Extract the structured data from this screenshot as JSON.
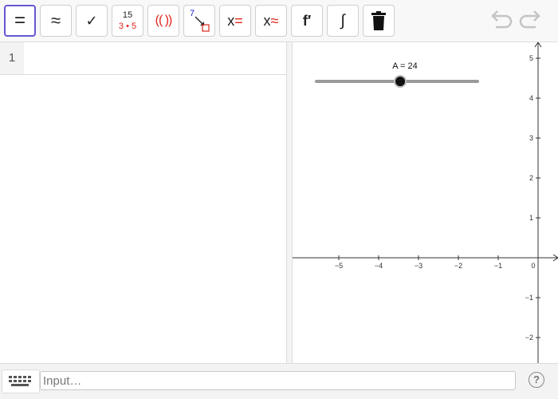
{
  "toolbar": {
    "buttons": [
      {
        "name": "evaluate",
        "label": "="
      },
      {
        "name": "numeric",
        "label": "≈"
      },
      {
        "name": "keep-input",
        "label": "✓"
      },
      {
        "name": "factor",
        "label_top": "15",
        "label_bottom": "3 • 5"
      },
      {
        "name": "expand",
        "label": "(( ))"
      },
      {
        "name": "substitute",
        "label": "7"
      },
      {
        "name": "solve",
        "label": "x="
      },
      {
        "name": "solve-numerically",
        "label": "x≈"
      },
      {
        "name": "derivative",
        "label": "f′"
      },
      {
        "name": "integral",
        "label": "∫"
      },
      {
        "name": "delete",
        "label": ""
      }
    ]
  },
  "algebra": {
    "rows": [
      {
        "number": "1",
        "content": ""
      }
    ]
  },
  "graphics": {
    "slider": {
      "label": "A = 24",
      "value": 24,
      "fraction": 0.52
    },
    "x_ticks": [
      "−5",
      "−4",
      "−3",
      "−2",
      "−1",
      "0"
    ],
    "y_ticks": [
      "5",
      "4",
      "3",
      "2",
      "1",
      "−1",
      "−2"
    ]
  },
  "input_bar": {
    "placeholder": "Input…"
  },
  "help": {
    "label": "?"
  },
  "colors": {
    "accent": "#6557d2",
    "red": "#e0241a",
    "blue": "#1a25c8"
  }
}
